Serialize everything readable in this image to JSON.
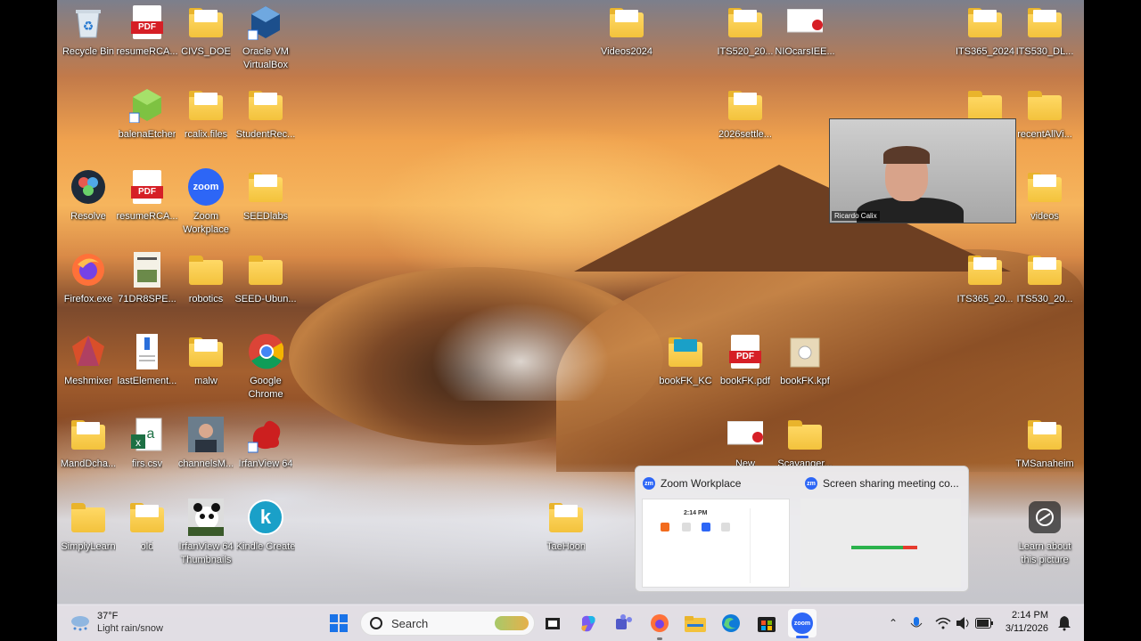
{
  "desktop": {
    "icons": [
      {
        "id": "recycle",
        "label": "Recycle Bin",
        "kind": "recycle"
      },
      {
        "id": "resume1",
        "label": "resumeRCA...",
        "kind": "pdf"
      },
      {
        "id": "civs",
        "label": "CIVS_DOE",
        "kind": "folder"
      },
      {
        "id": "oraclevm",
        "label": "Oracle VM VirtualBox",
        "kind": "app",
        "color": "#1c4f8c"
      },
      {
        "id": "balena",
        "label": "balenaEtcher",
        "kind": "app",
        "color": "#7ec242"
      },
      {
        "id": "rcalix",
        "label": "rcalix.files",
        "kind": "folder"
      },
      {
        "id": "studentrec",
        "label": "StudentRec...",
        "kind": "folder"
      },
      {
        "id": "resolve",
        "label": "Resolve",
        "kind": "app",
        "color": "#1e2b3a"
      },
      {
        "id": "resume2",
        "label": "resumeRCA...",
        "kind": "pdf"
      },
      {
        "id": "zoomws",
        "label": "Zoom Workplace",
        "kind": "app",
        "color": "#2d66f6"
      },
      {
        "id": "seedlabs",
        "label": "SEEDlabs",
        "kind": "folder"
      },
      {
        "id": "firefox",
        "label": "Firefox.exe",
        "kind": "app",
        "color": "#ff7139"
      },
      {
        "id": "dr8spe",
        "label": "71DR8SPE...",
        "kind": "doc"
      },
      {
        "id": "robotics",
        "label": "robotics",
        "kind": "folder"
      },
      {
        "id": "seedubun",
        "label": "SEED-Ubun...",
        "kind": "folder"
      },
      {
        "id": "meshmixer",
        "label": "Meshmixer",
        "kind": "app",
        "color": "#d94f2a"
      },
      {
        "id": "lastelement",
        "label": "lastElement...",
        "kind": "doc"
      },
      {
        "id": "malw",
        "label": "malw",
        "kind": "folder"
      },
      {
        "id": "chrome",
        "label": "Google Chrome",
        "kind": "app",
        "color": "#4285f4"
      },
      {
        "id": "mandd",
        "label": "MandDcha...",
        "kind": "folder"
      },
      {
        "id": "firscsv",
        "label": "firs.csv",
        "kind": "app",
        "color": "#1d7044"
      },
      {
        "id": "channelsm",
        "label": "channelsM...",
        "kind": "doc"
      },
      {
        "id": "irfan64",
        "label": "IrfanView 64",
        "kind": "app",
        "color": "#cc1f1f"
      },
      {
        "id": "simplylearn",
        "label": "SimplyLearn",
        "kind": "folder"
      },
      {
        "id": "old",
        "label": "old",
        "kind": "folder"
      },
      {
        "id": "irfanthumb",
        "label": "IrfanView 64 Thumbnails",
        "kind": "app",
        "color": "#333333"
      },
      {
        "id": "kindle",
        "label": "Kindle Create",
        "kind": "app",
        "color": "#1aa0c8"
      },
      {
        "id": "videos2024",
        "label": "Videos2024",
        "kind": "folder"
      },
      {
        "id": "its520",
        "label": "ITS520_20...",
        "kind": "folder"
      },
      {
        "id": "niocars",
        "label": "NIOcarsIEE...",
        "kind": "doc"
      },
      {
        "id": "its365a",
        "label": "ITS365_2024",
        "kind": "folder"
      },
      {
        "id": "its530a",
        "label": "ITS530_DL...",
        "kind": "folder"
      },
      {
        "id": "settle2026",
        "label": "2026settle...",
        "kind": "folder"
      },
      {
        "id": "recentall",
        "label": "recentAllVi...",
        "kind": "folder"
      },
      {
        "id": "videos",
        "label": "videos",
        "kind": "folder"
      },
      {
        "id": "its365b",
        "label": "ITS365_20...",
        "kind": "folder"
      },
      {
        "id": "its530b",
        "label": "ITS530_20...",
        "kind": "folder"
      },
      {
        "id": "bookfkkc",
        "label": "bookFK_KC",
        "kind": "folder"
      },
      {
        "id": "bookfkpdf",
        "label": "bookFK.pdf",
        "kind": "pdf"
      },
      {
        "id": "bookfkkpf",
        "label": "bookFK.kpf",
        "kind": "doc"
      },
      {
        "id": "new",
        "label": "New",
        "kind": "doc"
      },
      {
        "id": "scavanger",
        "label": "Scavanger...",
        "kind": "folder"
      },
      {
        "id": "tmsanaheim",
        "label": "TMSanaheim",
        "kind": "folder"
      },
      {
        "id": "taehoon",
        "label": "TaeHoon",
        "kind": "folder"
      },
      {
        "id": "learnabout",
        "label": "Learn about this picture",
        "kind": "app",
        "color": "#444444"
      }
    ],
    "pdf_tag": "PDF",
    "zoom_logo_text": "zoom",
    "kindle_letter": "k"
  },
  "webcam": {
    "name": "Ricardo Calix"
  },
  "zoom_preview": {
    "window1_title": "Zoom Workplace",
    "window2_title": "Screen sharing meeting co...",
    "badge": "zm",
    "thumb_time": "2:14 PM"
  },
  "taskbar": {
    "weather_temp": "37°F",
    "weather_desc": "Light rain/snow",
    "search_placeholder": "Search",
    "zoom_app_text": "zoom",
    "time": "2:14 PM",
    "date": "3/11/2026"
  }
}
